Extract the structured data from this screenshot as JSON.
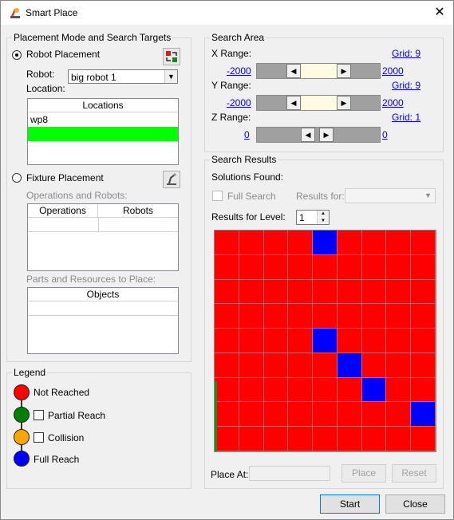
{
  "window": {
    "title": "Smart Place",
    "close_glyph": "✕"
  },
  "placement": {
    "group_label": "Placement Mode and Search Targets",
    "robot_placement_label": "Robot Placement",
    "robot_label": "Robot:",
    "robot_value": "big robot 1",
    "location_label": "Location:",
    "locations_header": "Locations",
    "locations": [
      "wp8",
      ""
    ],
    "fixture_placement_label": "Fixture Placement",
    "ops_label": "Operations and Robots:",
    "ops_headers": [
      "Operations",
      "Robots"
    ],
    "parts_label": "Parts and Resources to Place:",
    "objects_header": "Objects"
  },
  "legend": {
    "group_label": "Legend",
    "items": [
      {
        "label": "Not Reached",
        "color": "#ff0000",
        "has_checkbox": false
      },
      {
        "label": "Partial Reach",
        "color": "#008000",
        "has_checkbox": true
      },
      {
        "label": "Collision",
        "color": "#ffa500",
        "has_checkbox": true
      },
      {
        "label": "Full Reach",
        "color": "#0000ff",
        "has_checkbox": false
      }
    ]
  },
  "search_area": {
    "group_label": "Search Area",
    "x": {
      "label": "X Range:",
      "min": "-2000",
      "max": "2000",
      "grid": "Grid: 9"
    },
    "y": {
      "label": "Y Range:",
      "min": "-2000",
      "max": "2000",
      "grid": "Grid: 9"
    },
    "z": {
      "label": "Z Range:",
      "min": "0",
      "max": "0",
      "grid": "Grid: 1"
    }
  },
  "search_results": {
    "group_label": "Search Results",
    "solutions_label": "Solutions Found:",
    "full_search_label": "Full Search",
    "results_for_label": "Results for:",
    "results_for_value": "",
    "level_label": "Results for Level:",
    "level_value": "1",
    "place_at_label": "Place At:",
    "place_at_value": "",
    "place_button": "Place",
    "reset_button": "Reset",
    "grid_rows": 9,
    "grid_cols": 9,
    "grid_colors": {
      "not_reached": "#ff0000",
      "full_reach": "#0000ff"
    },
    "full_reach_cells": [
      [
        0,
        4
      ],
      [
        4,
        4
      ],
      [
        5,
        5
      ],
      [
        6,
        6
      ],
      [
        7,
        8
      ]
    ]
  },
  "footer": {
    "start_button": "Start",
    "close_button": "Close"
  },
  "colors": {
    "selected_row": "#00ff00",
    "link": "#0000ee"
  }
}
